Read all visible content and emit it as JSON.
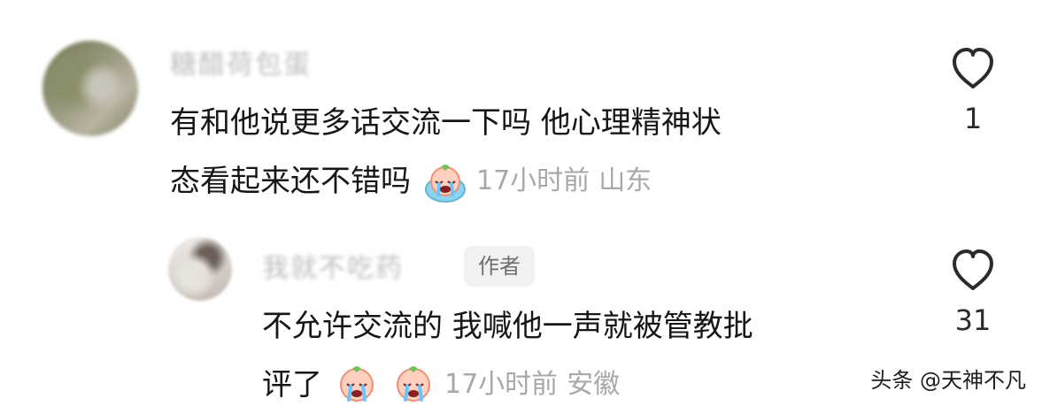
{
  "comments": [
    {
      "username": "糖醋荷包蛋",
      "text_line1": "有和他说更多话交流一下吗 他心理精神状",
      "text_line2": "态看起来还不错吗",
      "time": "17小时前",
      "location": "山东",
      "like_count": "1",
      "emoji": "crying-emoji"
    },
    {
      "username": "我就不吃药",
      "badge": "作者",
      "text_line1": "不允许交流的 我喊他一声就被管教批",
      "text_line2": "评了",
      "time": "17小时前",
      "location": "安徽",
      "like_count": "31",
      "emoji": "crying-emoji"
    }
  ],
  "watermark": "头条 @天神不凡",
  "colors": {
    "text": "#161616",
    "meta": "#a8a8a8",
    "badge_bg": "#f1f1f1",
    "heart": "#2b2b2b"
  }
}
